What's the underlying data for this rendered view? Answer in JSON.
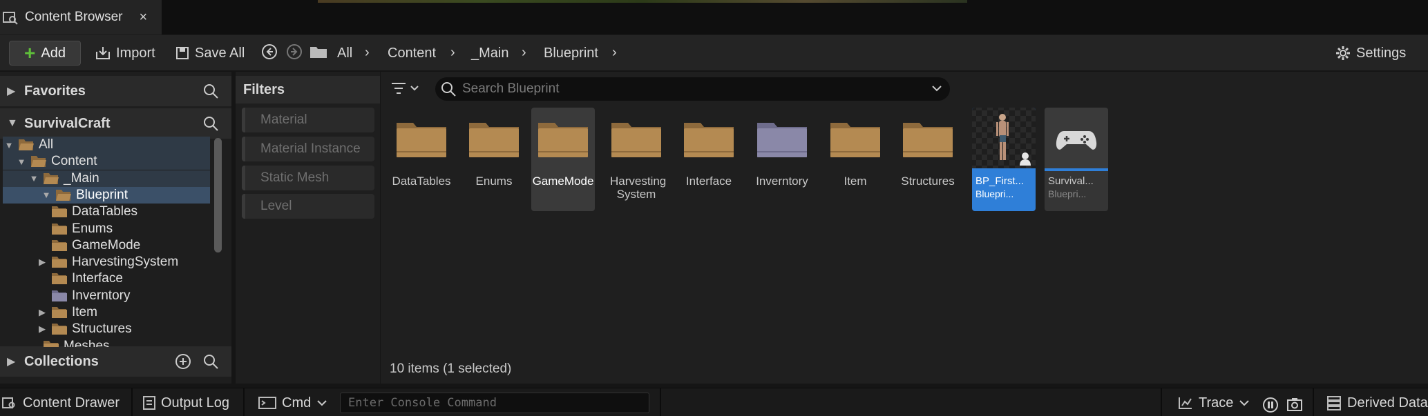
{
  "window": {
    "tab_title": "Content Browser",
    "close_glyph": "×"
  },
  "toolbar": {
    "add_label": "Add",
    "import_label": "Import",
    "save_all_label": "Save All",
    "settings_label": "Settings",
    "breadcrumb": [
      "All",
      "Content",
      "_Main",
      "Blueprint"
    ]
  },
  "sidebar": {
    "favorites_label": "Favorites",
    "project_label": "SurvivalCraft",
    "collections_label": "Collections",
    "tree": [
      {
        "label": "All",
        "level": 0,
        "expanded": true
      },
      {
        "label": "Content",
        "level": 1,
        "expanded": true
      },
      {
        "label": "_Main",
        "level": 2,
        "expanded": true
      },
      {
        "label": "Blueprint",
        "level": 3,
        "expanded": true,
        "selected": true
      },
      {
        "label": "DataTables",
        "level": 4
      },
      {
        "label": "Enums",
        "level": 4
      },
      {
        "label": "GameMode",
        "level": 4
      },
      {
        "label": "HarvestingSystem",
        "level": 4,
        "has_children": true
      },
      {
        "label": "Interface",
        "level": 4
      },
      {
        "label": "Inverntory",
        "level": 4,
        "tint": "purple"
      },
      {
        "label": "Item",
        "level": 4,
        "has_children": true
      },
      {
        "label": "Structures",
        "level": 4,
        "has_children": true
      },
      {
        "label": "Meshes",
        "level": 2
      }
    ]
  },
  "filters": {
    "title": "Filters",
    "items": [
      "Material",
      "Material Instance",
      "Static Mesh",
      "Level"
    ]
  },
  "content": {
    "search_placeholder": "Search Blueprint",
    "folders": [
      {
        "label": "DataTables"
      },
      {
        "label": "Enums"
      },
      {
        "label": "GameMode",
        "hover": true
      },
      {
        "label": "Harvesting System"
      },
      {
        "label": "Interface"
      },
      {
        "label": "Inverntory",
        "tint": "purple"
      },
      {
        "label": "Item"
      },
      {
        "label": "Structures"
      }
    ],
    "assets": [
      {
        "name": "BP_First...",
        "type": "Bluepri...",
        "selected": true
      },
      {
        "name": "Surviv al...",
        "type": "Bluepri..."
      }
    ],
    "status": "10 items (1 selected)"
  },
  "bottom_bar": {
    "content_drawer_label": "Content Drawer",
    "output_log_label": "Output Log",
    "cmd_label": "Cmd",
    "console_placeholder": "Enter Console Command",
    "trace_label": "Trace",
    "derived_data_label": "Derived Data"
  },
  "colors": {
    "folder": "#b48a52",
    "folder_purple": "#8a88a8",
    "selection": "#2f7fd8",
    "add_plus": "#5fbf3a"
  }
}
